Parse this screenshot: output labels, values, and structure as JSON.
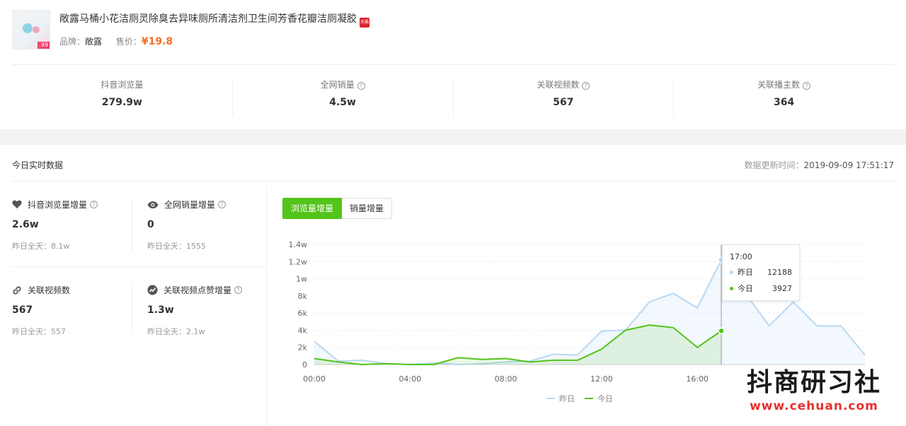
{
  "product": {
    "title": "敞露马桶小花洁厕灵除臭去异味厕所清洁剂卫生间芳香花瓣洁厕凝胶",
    "tmall_badge": "天猫",
    "thumb_price": ".99",
    "brand_label": "品牌：",
    "brand": "敞露",
    "price_label": "售价：",
    "price": "¥19.8"
  },
  "stats": [
    {
      "label": "抖音浏览量",
      "value": "279.9w",
      "help": false
    },
    {
      "label": "全网销量",
      "value": "4.5w",
      "help": true
    },
    {
      "label": "关联视频数",
      "value": "567",
      "help": true
    },
    {
      "label": "关联播主数",
      "value": "364",
      "help": true
    }
  ],
  "today": {
    "title": "今日实时数据",
    "updated_label": "数据更新时间：",
    "updated_time": "2019-09-09 17:51:17"
  },
  "metrics": [
    {
      "label": "抖音浏览量增量",
      "value": "2.6w",
      "prev": "昨日全天：8.1w",
      "icon": "heart-icon"
    },
    {
      "label": "全网销量增量",
      "value": "0",
      "prev": "昨日全天：1555",
      "icon": "eye-icon"
    },
    {
      "label": "关联视频数",
      "value": "567",
      "prev": "昨日全天：557",
      "icon": "link-icon"
    },
    {
      "label": "关联视频点赞增量",
      "value": "1.3w",
      "prev": "昨日全天：2.1w",
      "icon": "trend-icon"
    }
  ],
  "help_glyph": "?",
  "tabs": {
    "active": "浏览量增量",
    "inactive": "销量增量"
  },
  "colors": {
    "yesterday": "#b7d8f5",
    "today": "#52c41a",
    "accent": "#f56c2b"
  },
  "tooltip": {
    "time": "17:00",
    "rows": [
      {
        "name": "昨日",
        "value": "12188"
      },
      {
        "name": "今日",
        "value": "3927"
      }
    ]
  },
  "chart_data": {
    "type": "area",
    "x": [
      "00:00",
      "01:00",
      "02:00",
      "03:00",
      "04:00",
      "05:00",
      "06:00",
      "07:00",
      "08:00",
      "09:00",
      "10:00",
      "11:00",
      "12:00",
      "13:00",
      "14:00",
      "15:00",
      "16:00",
      "17:00",
      "18:00",
      "19:00",
      "20:00",
      "21:00",
      "22:00",
      "23:00"
    ],
    "x_ticks": [
      "00:00",
      "04:00",
      "08:00",
      "12:00",
      "16:00"
    ],
    "y_ticks": [
      "0",
      "2k",
      "4k",
      "6k",
      "8k",
      "1w",
      "1.2w",
      "1.4w"
    ],
    "ylim": [
      0,
      14000
    ],
    "series": [
      {
        "name": "昨日",
        "values": [
          2700,
          400,
          500,
          100,
          0,
          200,
          0,
          100,
          300,
          400,
          1200,
          1100,
          3900,
          4000,
          7300,
          8300,
          6600,
          12188,
          8300,
          4500,
          7300,
          4500,
          4500,
          1100
        ]
      },
      {
        "name": "今日",
        "values": [
          700,
          300,
          0,
          100,
          0,
          0,
          800,
          600,
          700,
          300,
          500,
          500,
          1800,
          4000,
          4600,
          4300,
          2000,
          3927
        ]
      }
    ],
    "legend_position": "bottom-center",
    "grid": true
  },
  "watermark": {
    "line1": "抖商研习社",
    "line2": "www.cehuan.com"
  }
}
